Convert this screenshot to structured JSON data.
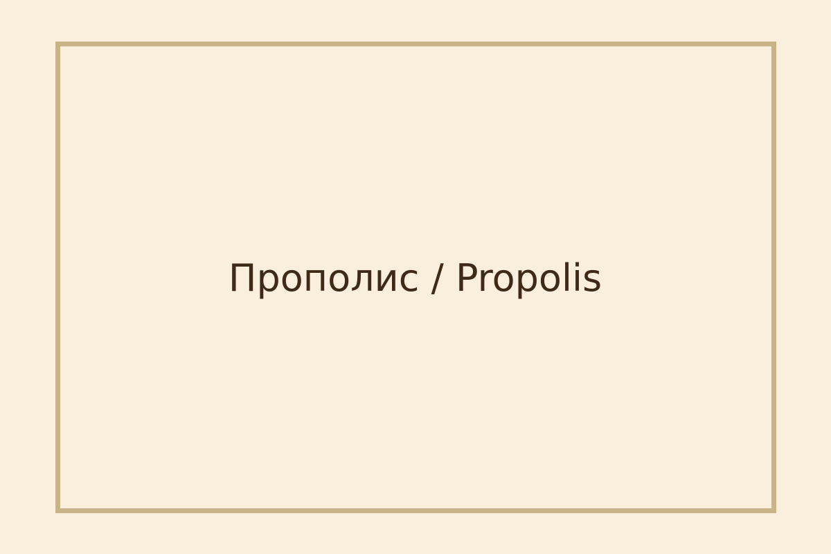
{
  "label": {
    "text": "Прополис / Propolis"
  },
  "colors": {
    "background": "#faefdc",
    "frame_border": "#c9b48a",
    "text": "#3f2a18"
  }
}
